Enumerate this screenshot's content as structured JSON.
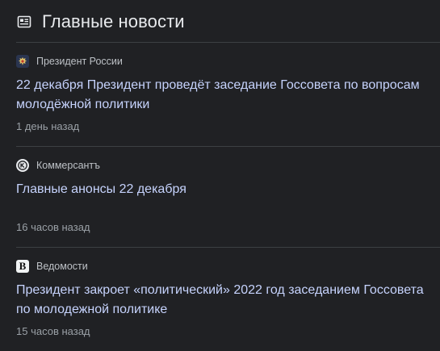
{
  "header": {
    "title": "Главные новости",
    "icon": "news-icon"
  },
  "articles": [
    {
      "source": "Президент России",
      "logo": "russia-emblem-icon",
      "headline": "22 декабря Президент проведёт заседание Госсовета по вопросам молодёжной политики",
      "time": "1 день назад"
    },
    {
      "source": "Коммерсантъ",
      "logo": "kommersant-logo-icon",
      "headline": "Главные анонсы 22 декабря",
      "time": "16 часов назад"
    },
    {
      "source": "Ведомости",
      "logo": "vedomosti-logo-icon",
      "logo_letter": "В",
      "headline": "Президент закроет «политический» 2022 год заседанием Госсовета по молодежной политике",
      "time": "15 часов назад"
    }
  ],
  "colors": {
    "background": "#202124",
    "headline": "#c6d3fd",
    "divider": "#3c4043"
  }
}
